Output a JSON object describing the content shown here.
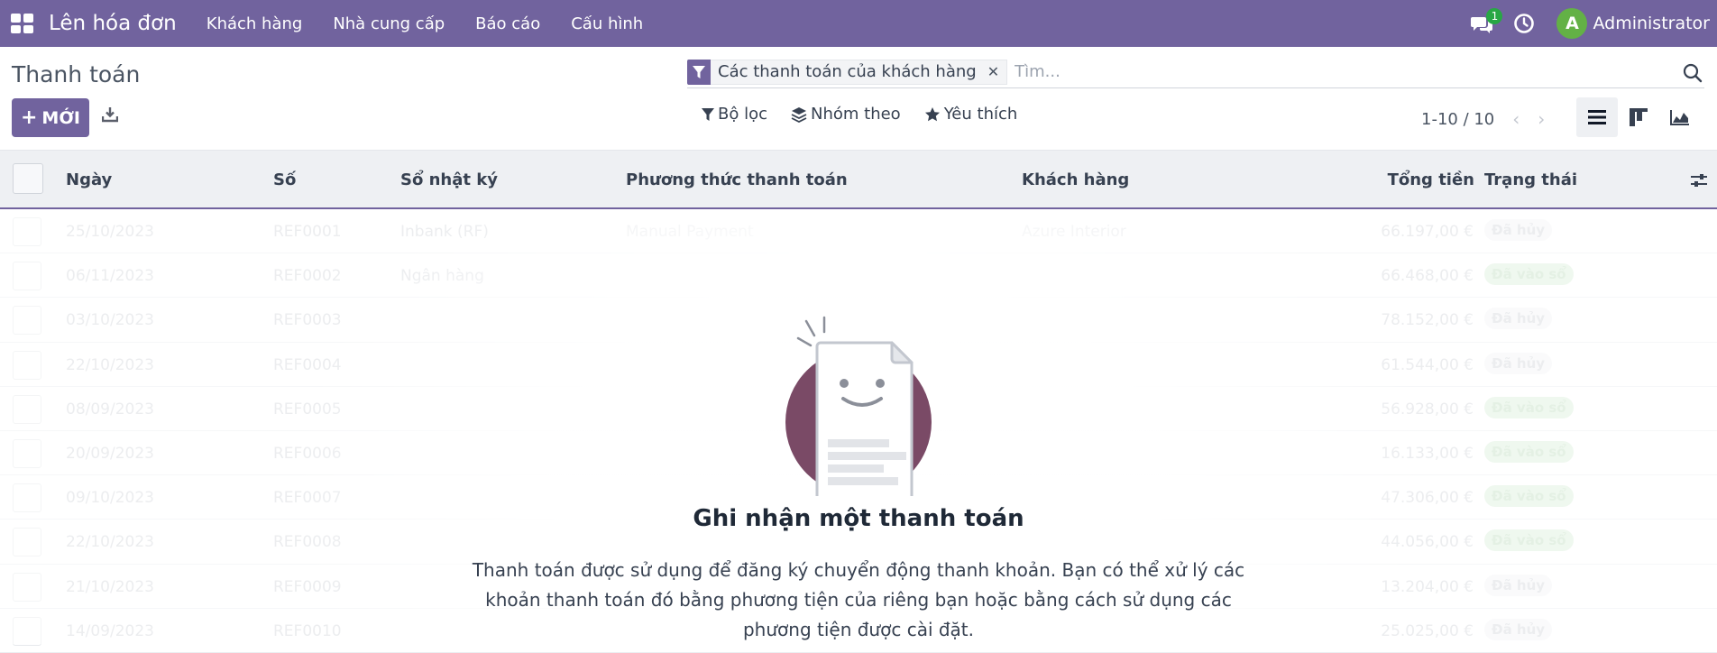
{
  "topbar": {
    "app_name": "Lên hóa đơn",
    "menu": [
      "Khách hàng",
      "Nhà cung cấp",
      "Báo cáo",
      "Cấu hình"
    ],
    "chat_badge": "1",
    "avatar_letter": "A",
    "user_name": "Administrator"
  },
  "control": {
    "title": "Thanh toán",
    "new_label": "MỚI",
    "search_facet": "Các thanh toán của khách hàng",
    "search_placeholder": "Tìm...",
    "filter_label": "Bộ lọc",
    "group_label": "Nhóm theo",
    "favorite_label": "Yêu thích",
    "pager": "1-10 / 10"
  },
  "table": {
    "columns": [
      "Ngày",
      "Số",
      "Sổ nhật ký",
      "Phương thức thanh toán",
      "Khách hàng",
      "Tổng tiền",
      "Trạng thái"
    ],
    "rows": [
      {
        "date": "25/10/2023",
        "number": "REF0001",
        "journal": "Inbank (RF)",
        "method": "Manual Payment",
        "customer": "Azure Interior",
        "amount": "66.197,00 €",
        "status": "Đã hủy",
        "status_kind": "cancel"
      },
      {
        "date": "06/11/2023",
        "number": "REF0002",
        "journal": "Ngân hàng",
        "method": "",
        "customer": "",
        "amount": "66.468,00 €",
        "status": "Đã vào sổ",
        "status_kind": "posted"
      },
      {
        "date": "03/10/2023",
        "number": "REF0003",
        "journal": "",
        "method": "",
        "customer": "",
        "amount": "78.152,00 €",
        "status": "Đã hủy",
        "status_kind": "cancel"
      },
      {
        "date": "22/10/2023",
        "number": "REF0004",
        "journal": "",
        "method": "",
        "customer": "",
        "amount": "61.544,00 €",
        "status": "Đã hủy",
        "status_kind": "cancel"
      },
      {
        "date": "08/09/2023",
        "number": "REF0005",
        "journal": "",
        "method": "",
        "customer": "",
        "amount": "56.928,00 €",
        "status": "Đã vào sổ",
        "status_kind": "posted"
      },
      {
        "date": "20/09/2023",
        "number": "REF0006",
        "journal": "",
        "method": "",
        "customer": "",
        "amount": "16.133,00 €",
        "status": "Đã vào sổ",
        "status_kind": "posted"
      },
      {
        "date": "09/10/2023",
        "number": "REF0007",
        "journal": "",
        "method": "",
        "customer": "",
        "amount": "47.306,00 €",
        "status": "Đã vào sổ",
        "status_kind": "posted"
      },
      {
        "date": "22/10/2023",
        "number": "REF0008",
        "journal": "",
        "method": "",
        "customer": "",
        "amount": "44.056,00 €",
        "status": "Đã vào sổ",
        "status_kind": "posted"
      },
      {
        "date": "21/10/2023",
        "number": "REF0009",
        "journal": "",
        "method": "",
        "customer": "",
        "amount": "13.204,00 €",
        "status": "Đã hủy",
        "status_kind": "cancel"
      },
      {
        "date": "14/09/2023",
        "number": "REF0010",
        "journal": "",
        "method": "",
        "customer": "",
        "amount": "25.025,00 €",
        "status": "Đã hủy",
        "status_kind": "cancel"
      }
    ]
  },
  "helper": {
    "title": "Ghi nhận một thanh toán",
    "text": "Thanh toán được sử dụng để đăng ký chuyển động thanh khoản. Bạn có thể xử lý các khoản thanh toán đó bằng phương tiện của riêng bạn hoặc bằng cách sử dụng các phương tiện được cài đặt."
  },
  "colors": {
    "brand": "#71639e",
    "posted": "#28a745"
  }
}
